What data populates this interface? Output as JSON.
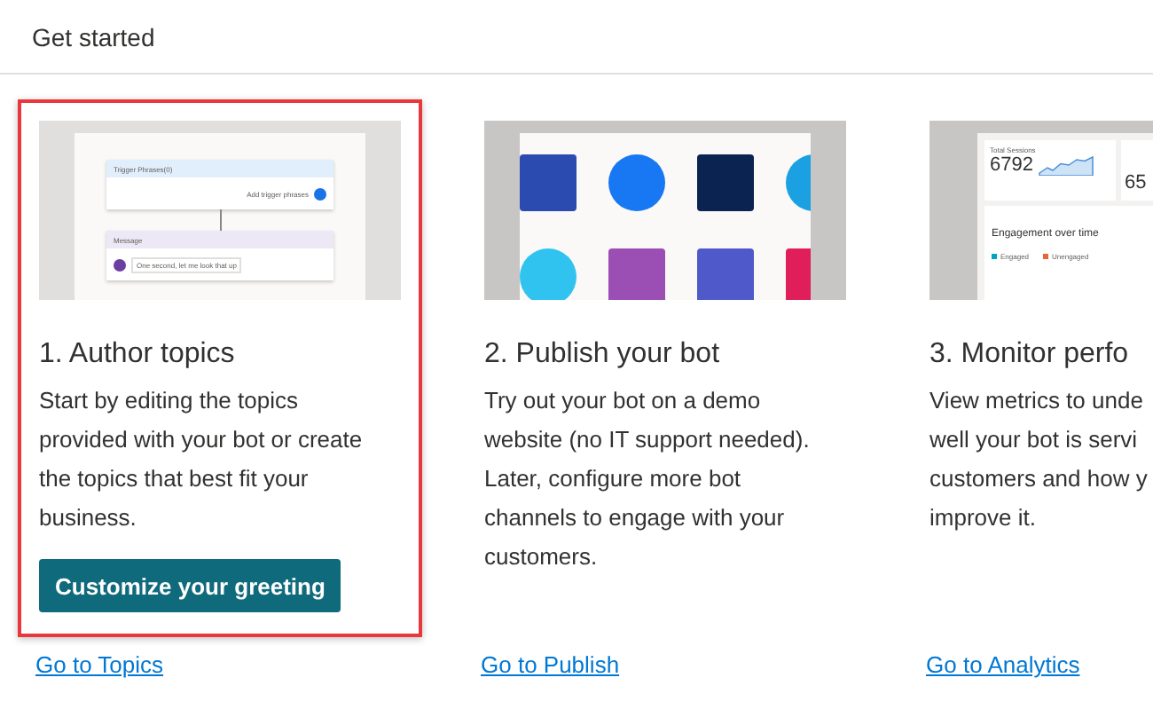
{
  "header": {
    "title": "Get started"
  },
  "cards": [
    {
      "kind": "topics",
      "selected": true,
      "title": "1. Author topics",
      "description": "Start by editing the topics\nprovided with your bot or create\nthe topics that best fit your\nbusiness.",
      "button": "Customize your greeting",
      "link": "Go to Topics",
      "thumbnail": {
        "trigger_title": "Trigger Phrases(0)",
        "trigger_action": "Add trigger phrases",
        "message_title": "Message",
        "message_text": "One second, let me look that up"
      }
    },
    {
      "kind": "publish",
      "selected": false,
      "title": "2. Publish your bot",
      "description": "Try out your bot on a demo\nwebsite (no IT support needed).\nLater, configure more bot\nchannels to engage with your\ncustomers.",
      "link": "Go to Publish",
      "thumbnail": {
        "channels": [
          {
            "color": "#2b4bb0"
          },
          {
            "color": "#1877f2"
          },
          {
            "color": "#0b2350"
          },
          {
            "color": "#1ba1e2"
          },
          {
            "color": "#31c3f0"
          },
          {
            "color": "#9b4fb5"
          },
          {
            "color": "#5059c9"
          },
          {
            "color": "#e01e5a"
          }
        ]
      }
    },
    {
      "kind": "analytics",
      "selected": false,
      "title": "3. Monitor perfo",
      "description": "View metrics to unde\nwell your bot is servi\ncustomers and how y\nimprove it.",
      "link": "Go to Analytics",
      "thumbnail": {
        "metric_label": "Total Sessions",
        "metric_value": "6792",
        "second_value": "65",
        "chart_title": "Engagement over time",
        "legend": [
          {
            "label": "Engaged",
            "color": "#00a3c4"
          },
          {
            "label": "Unengaged",
            "color": "#e8663c"
          }
        ]
      }
    }
  ]
}
